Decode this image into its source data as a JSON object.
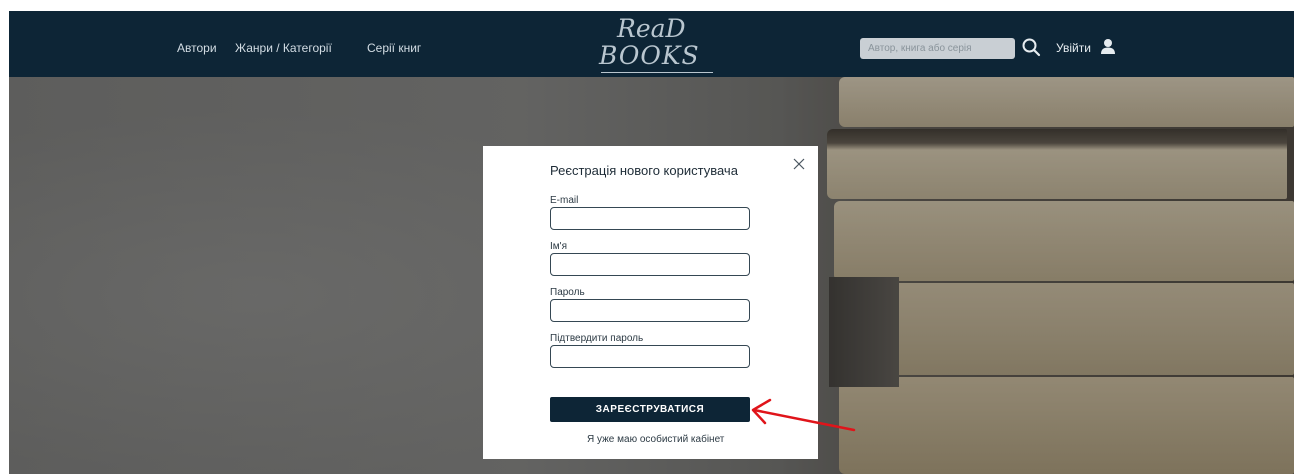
{
  "header": {
    "nav": [
      {
        "label": "Автори"
      },
      {
        "label": "Жанри / Категорії"
      },
      {
        "label": "Серії книг"
      }
    ],
    "logo": {
      "line1": "ReaD",
      "line2": "BOOKS"
    },
    "search": {
      "placeholder": "Автор, книга або серія"
    },
    "login_label": "Увійти"
  },
  "modal": {
    "title": "Реєстрація нового користувача",
    "fields": [
      {
        "label": "E-mail",
        "value": ""
      },
      {
        "label": "Ім'я",
        "value": ""
      },
      {
        "label": "Пароль",
        "value": ""
      },
      {
        "label": "Підтвердити пароль",
        "value": ""
      }
    ],
    "submit_label": "ЗАРЕЄСТРУВАТИСЯ",
    "login_link": "Я уже маю особистий кабінет"
  },
  "colors": {
    "header_bg": "#0d2536",
    "button_bg": "#0d2536",
    "annotation_arrow": "#e0141a"
  },
  "icons": [
    "search-icon",
    "user-icon",
    "close-icon"
  ]
}
